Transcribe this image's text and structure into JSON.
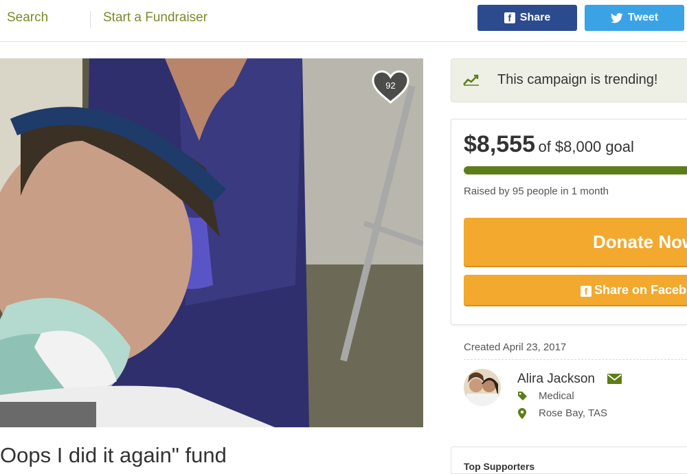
{
  "nav": {
    "search_label": "Search",
    "start_label": "Start a Fundraiser"
  },
  "social": {
    "share_label": "Share",
    "tweet_label": "Tweet"
  },
  "campaign": {
    "heart_count": "92",
    "title": "Oops I did it again\" fund",
    "trending_text": "This campaign is trending!",
    "amount_raised": "$8,555",
    "goal_text": "of $8,000 goal",
    "progress_fraction": 1.0,
    "raised_by": "Raised by 95 people in 1 month",
    "donate_label": "Donate Now",
    "share_fb_label": "Share on Facebook",
    "created": "Created April 23, 2017",
    "organizer_name": "Alira Jackson",
    "category": "Medical",
    "location": "Rose Bay, TAS",
    "supporters_title": "Top Supporters"
  },
  "colors": {
    "brand_green": "#5d7d17",
    "donate_orange": "#f2a92e",
    "facebook_blue": "#2c4a8e",
    "twitter_blue": "#3aa3e6"
  }
}
